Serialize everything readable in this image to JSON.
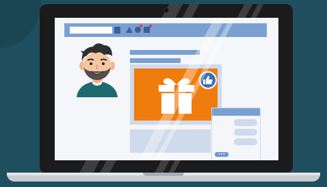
{
  "scene": {
    "type": "laptop-social-feed-illustration",
    "colors": {
      "background": "#1f4f5f",
      "laptop_frame": "#1b1b1b",
      "screen": "#f4f6fa",
      "ui_blue": "#7aa0d2",
      "ui_dark_blue": "#3b5f97",
      "card_light": "#cfdaeb",
      "accent_orange": "#f07c0d",
      "notification_red": "#e03a3a",
      "like_badge": "#3b6fb6"
    }
  },
  "topbar": {
    "search_icon": "search-button-icon",
    "nav_icons": [
      "triangle-icon",
      "circle-icon",
      "square-icon"
    ],
    "notification_count": 2
  },
  "profile": {
    "avatar_icon": "smiling-man-avatar"
  },
  "post": {
    "image_icon": "gift-box-icon",
    "reaction_icon": "thumbs-up-icon"
  },
  "chat": {
    "send_label": "•••"
  }
}
